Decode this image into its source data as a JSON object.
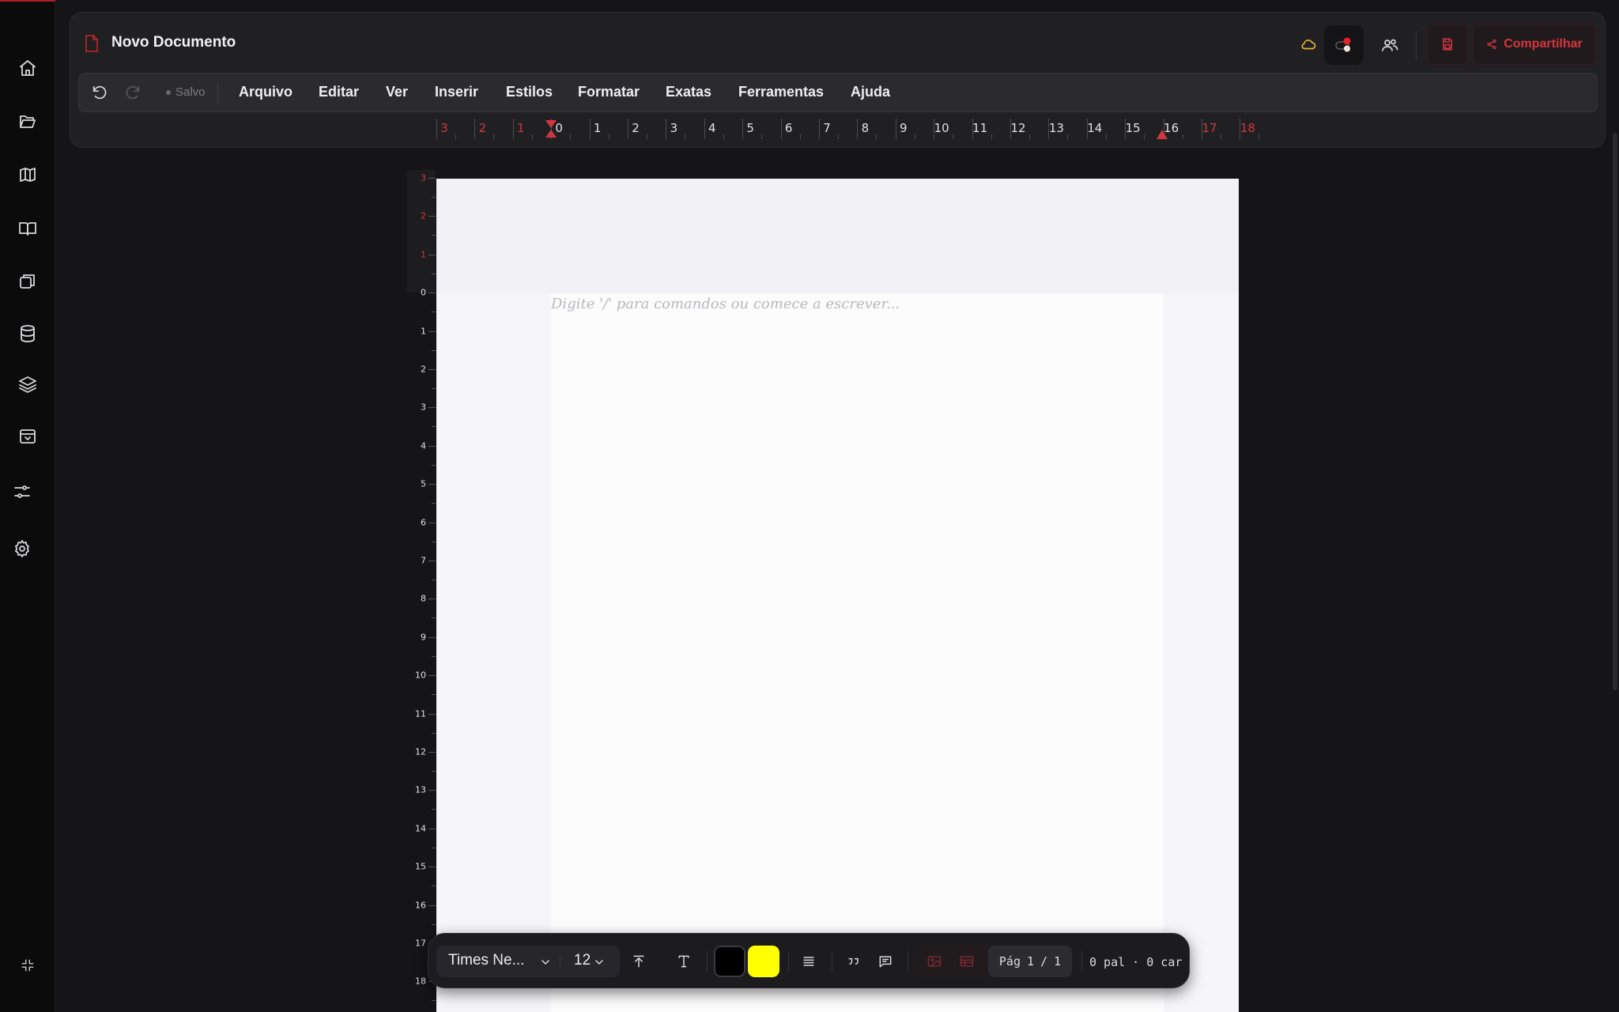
{
  "document": {
    "title": "Novo Documento",
    "placeholder": "Digite '/' para comandos ou comece a escrever..."
  },
  "rail": {
    "icons": [
      "home-icon",
      "folder-open-icon",
      "map-icon",
      "book-open-icon",
      "copy-icon",
      "database-icon",
      "layers-icon",
      "archive-icon",
      "sliders-icon",
      "settings-icon",
      "collapse-icon"
    ]
  },
  "header": {
    "share_label": "Compartilhar",
    "status_dot_color": "#e0242d",
    "cloud_color": "#e8b730"
  },
  "menubar": {
    "saved_label": "Salvo",
    "items": [
      "Arquivo",
      "Editar",
      "Ver",
      "Inserir",
      "Estilos",
      "Formatar",
      "Exatas",
      "Ferramentas",
      "Ajuda"
    ]
  },
  "ruler": {
    "horizontal": [
      "3",
      "2",
      "1",
      "0",
      "1",
      "2",
      "3",
      "4",
      "5",
      "6",
      "7",
      "8",
      "9",
      "10",
      "11",
      "12",
      "13",
      "14",
      "15",
      "16",
      "17",
      "18"
    ],
    "vertical": [
      "3",
      "2",
      "1",
      "0",
      "1",
      "2",
      "3",
      "4",
      "5",
      "6",
      "7",
      "8",
      "9",
      "10",
      "11",
      "12",
      "13",
      "14",
      "15",
      "16",
      "17",
      "18"
    ]
  },
  "toolbar": {
    "font_name": "Times Ne...",
    "font_size": "12",
    "text_color": "#000000",
    "highlight_color": "#ffff00",
    "page_label": "Pág",
    "page_current": "1",
    "page_sep": "/",
    "page_total": "1",
    "counts": "0 pal · 0 car"
  },
  "colors": {
    "accent": "#d2363f",
    "background": "#151517",
    "panel": "#202023"
  }
}
